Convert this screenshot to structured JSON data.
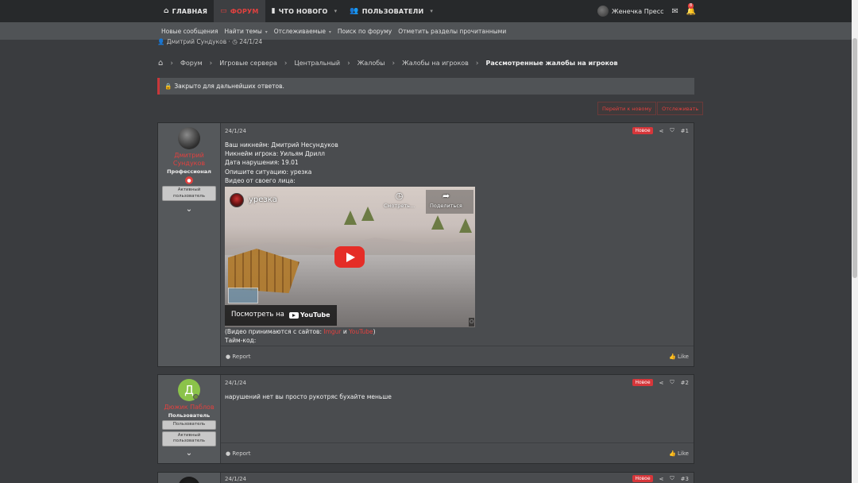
{
  "nav": {
    "tabs": [
      {
        "label": "ГЛАВНАЯ",
        "icon": "home-icon"
      },
      {
        "label": "ФОРУМ",
        "icon": "forum-icon"
      },
      {
        "label": "ЧТО НОВОГО",
        "icon": "whats-new-icon"
      },
      {
        "label": "ПОЛЬЗОВАТЕЛИ",
        "icon": "users-icon"
      }
    ],
    "user_name": "Женечка Пресс",
    "alerts_count": "8"
  },
  "subnav": {
    "items": [
      "Новые сообщения",
      "Найти темы",
      "Отслеживаемые",
      "Поиск по форуму",
      "Отметить разделы прочитанными"
    ]
  },
  "thread": {
    "starter": "Дмитрий Сундуков",
    "start_date": "24/1/24",
    "closed_notice": "Закрыто для дальнейших ответов.",
    "btn_goto_new": "Перейти к новому",
    "btn_watch": "Отслеживать"
  },
  "breadcrumb": [
    "Форум",
    "Игровые сервера",
    "Центральный",
    "Жалобы",
    "Жалобы на игроков",
    "Рассмотренные жалобы на игроков"
  ],
  "posts": [
    {
      "author": "Дмитрий Сундуков",
      "user_title": "Профессионал",
      "banner": "Активный пользователь",
      "date": "24/1/24",
      "new_label": "Новое",
      "number": "#1",
      "lines": [
        "Ваш никнейм: Дмитрий Несундуков",
        "Никнейм игрока: Уильям Дрилл",
        "Дата нарушения: 19.01",
        "Опишите ситуацию: урезка",
        "Видео от своего лица:"
      ],
      "video": {
        "title": "урезка",
        "watch_later": "Смотреть...",
        "share": "Поделиться",
        "watch_on": "Посмотреть на",
        "platform": "YouTube"
      },
      "after_video_prefix": "(Видео принимаются с сайтов: ",
      "link1": "Imgur",
      "and_word": " и ",
      "link2": "YouTube",
      "after_video_suffix": ")",
      "timecode": "Тайм-код:",
      "report": "Report",
      "like": "Like"
    },
    {
      "author": "Дюжик Паблов",
      "avatar_letter": "Д",
      "user_title": "Пользователь",
      "banner1": "Пользователь",
      "banner2": "Активный пользователь",
      "date": "24/1/24",
      "new_label": "Новое",
      "number": "#2",
      "text": "нарушений нет вы просто рукотряс бухайте меньше",
      "report": "Report",
      "like": "Like"
    },
    {
      "date": "24/1/24",
      "new_label": "Новое",
      "number": "#3"
    }
  ]
}
